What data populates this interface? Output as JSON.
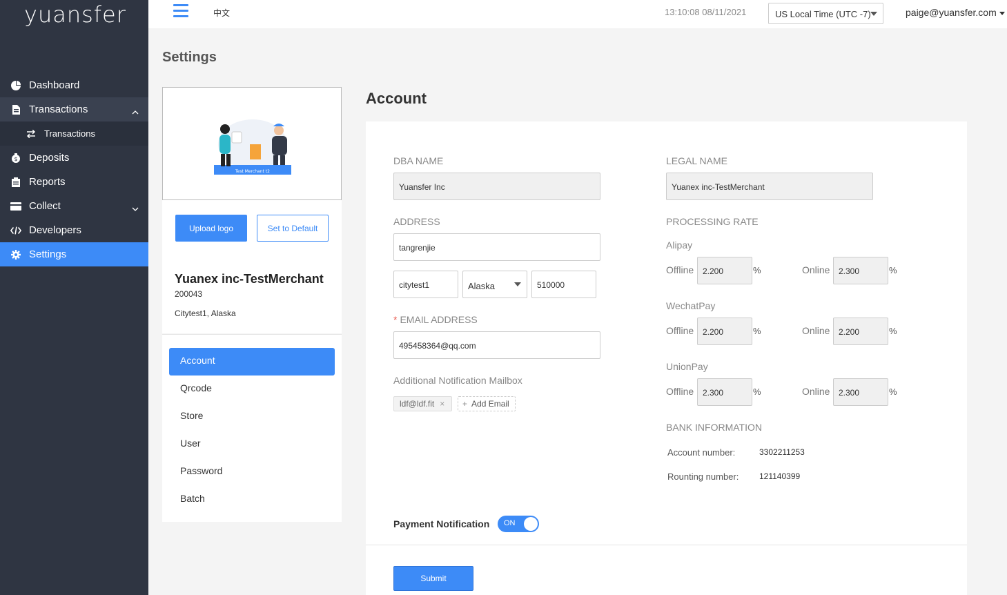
{
  "app": {
    "logo": "yuansfer"
  },
  "sidebar": {
    "items": [
      {
        "label": "Dashboard",
        "icon": "pie-chart-icon"
      },
      {
        "label": "Transactions",
        "icon": "document-icon",
        "expanded": true
      },
      {
        "label": "Transactions",
        "icon": "swap-arrows-icon",
        "sub": true
      },
      {
        "label": "Deposits",
        "icon": "money-bag-icon"
      },
      {
        "label": "Reports",
        "icon": "clipboard-icon"
      },
      {
        "label": "Collect",
        "icon": "credit-card-icon"
      },
      {
        "label": "Developers",
        "icon": "code-icon"
      },
      {
        "label": "Settings",
        "icon": "gear-icon",
        "active": true
      }
    ]
  },
  "topbar": {
    "language": "中文",
    "datetime": "13:10:08 08/11/2021",
    "timezone": "US Local Time (UTC -7)",
    "user_email": "paige@yuansfer.com"
  },
  "page_title": "Settings",
  "merchant": {
    "logo_caption": "Test Merchant t2",
    "upload_label": "Upload logo",
    "default_label": "Set to Default",
    "name": "Yuanex inc-TestMerchant",
    "id": "200043",
    "location": "Citytest1, Alaska"
  },
  "settings_menu": [
    "Account",
    "Qrcode",
    "Store",
    "User",
    "Password",
    "Batch"
  ],
  "account": {
    "title": "Account",
    "dba_label": "DBA NAME",
    "dba_value": "Yuansfer Inc",
    "legal_label": "LEGAL NAME",
    "legal_value": "Yuanex inc-TestMerchant",
    "address_label": "ADDRESS",
    "address_value": "tangrenjie",
    "city_value": "citytest1",
    "state_value": "Alaska",
    "zip_value": "510000",
    "email_label": "EMAIL ADDRESS",
    "email_value": "495458364@qq.com",
    "notify_mailbox_label": "Additional Notification Mailbox",
    "notify_tag": "ldf@ldf.fit",
    "tag_close": "×",
    "add_email_label": "Add Email",
    "add_icon": "+",
    "processing_label": "PROCESSING RATE",
    "offline_label": "Offline",
    "online_label": "Online",
    "percent": "%",
    "rates": [
      {
        "name": "Alipay",
        "offline": "2.200",
        "online": "2.300"
      },
      {
        "name": "WechatPay",
        "offline": "2.200",
        "online": "2.200"
      },
      {
        "name": "UnionPay",
        "offline": "2.300",
        "online": "2.300"
      }
    ],
    "bank_label": "BANK INFORMATION",
    "account_number_label": "Account number:",
    "account_number": "3302211253",
    "routing_number_label": "Rounting number:",
    "routing_number": "121140399",
    "payment_notification_label": "Payment Notification",
    "toggle_label": "ON",
    "submit_label": "Submit"
  }
}
